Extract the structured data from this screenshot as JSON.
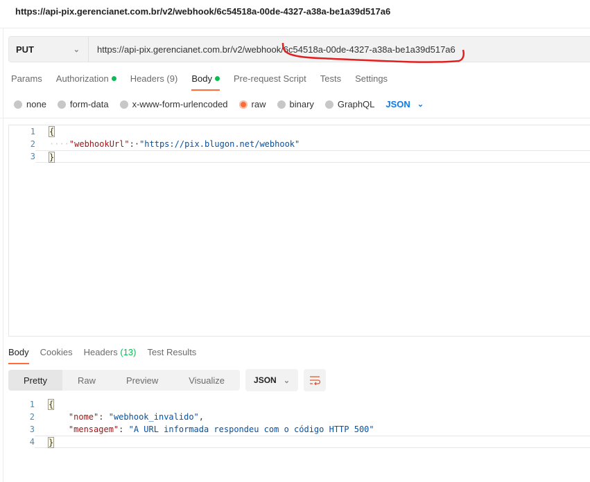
{
  "title": "https://api-pix.gerencianet.com.br/v2/webhook/6c54518a-00de-4327-a38a-be1a39d517a6",
  "request": {
    "method": "PUT",
    "url": "https://api-pix.gerencianet.com.br/v2/webhook/6c54518a-00de-4327-a38a-be1a39d517a6"
  },
  "tabs": [
    "Params",
    "Authorization",
    "Headers (9)",
    "Body",
    "Pre-request Script",
    "Tests",
    "Settings"
  ],
  "body_types": [
    "none",
    "form-data",
    "x-www-form-urlencoded",
    "raw",
    "binary",
    "GraphQL"
  ],
  "body_type_selected": "raw",
  "body_format": "JSON",
  "request_body": {
    "lines": [
      "1",
      "2",
      "3"
    ],
    "open": "{",
    "key": "\"webhookUrl\"",
    "value": "\"https://pix.blugon.net/webhook\"",
    "close": "}"
  },
  "response": {
    "tabs": {
      "body": "Body",
      "cookies": "Cookies",
      "headers": "Headers",
      "headers_count": "(13)",
      "tests": "Test Results"
    },
    "views": [
      "Pretty",
      "Raw",
      "Preview",
      "Visualize"
    ],
    "format": "JSON",
    "lines": [
      "1",
      "2",
      "3",
      "4"
    ],
    "open": "{",
    "k1": "\"nome\"",
    "v1": "\"webhook_invalido\"",
    "k2": "\"mensagem\"",
    "v2": "\"A URL informada respondeu com o código HTTP 500\"",
    "close": "}"
  },
  "colors": {
    "accent": "#ff6c37",
    "success": "#0cbb52",
    "link": "#097bed",
    "annotation": "#e02020"
  }
}
